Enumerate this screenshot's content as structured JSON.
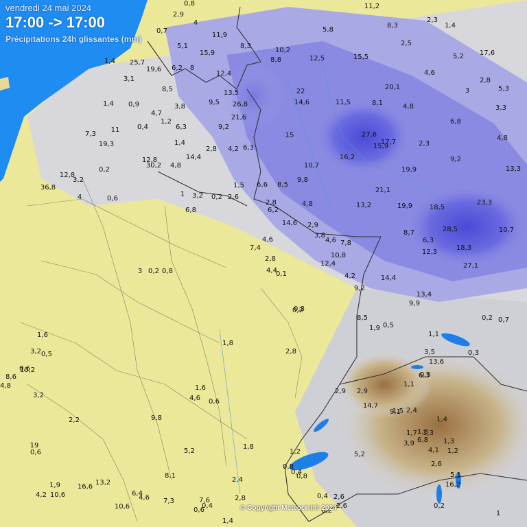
{
  "header": {
    "date": "vendredi 24 mai 2024",
    "time_range": "17:00 -> 17:00",
    "variable": "Précipitations 24h glissantes (mm)"
  },
  "copyright": "© Copyright Meteociel.fr 2024",
  "colors": {
    "sea": "#1e8cf0",
    "dry": "#f0ec9a",
    "light_gray": "#d6d6dc",
    "rain_light": "#a8a8e8",
    "rain_mid": "#8080e0",
    "rain_heavy": "#5a5ad8",
    "alps": "#b08a50"
  },
  "values": [
    {
      "t": "0,8"
    },
    {
      "t": "2,9"
    },
    {
      "t": "4"
    },
    {
      "t": "0,7"
    },
    {
      "t": "11,9"
    },
    {
      "t": "5,1"
    },
    {
      "t": "15,9"
    },
    {
      "t": "8,3"
    },
    {
      "t": "1,4"
    },
    {
      "t": "25,7"
    },
    {
      "t": "19,6"
    },
    {
      "t": "6,2"
    },
    {
      "t": "8"
    },
    {
      "t": "12,4"
    },
    {
      "t": "3,1"
    },
    {
      "t": "8,5"
    },
    {
      "t": "13,5"
    },
    {
      "t": "9,5"
    },
    {
      "t": "26,8"
    },
    {
      "t": "21,6"
    },
    {
      "t": "3,8"
    },
    {
      "t": "0,9"
    },
    {
      "t": "1,4"
    },
    {
      "t": "4,7"
    },
    {
      "t": "1,2"
    },
    {
      "t": "6,3"
    },
    {
      "t": "9,2"
    },
    {
      "t": "11"
    },
    {
      "t": "7,3"
    },
    {
      "t": "19,3"
    },
    {
      "t": "0,4"
    },
    {
      "t": "1,4"
    },
    {
      "t": "2,8"
    },
    {
      "t": "4,2"
    },
    {
      "t": "6,3"
    },
    {
      "t": "14,4"
    },
    {
      "t": "12,8"
    },
    {
      "t": "30,2"
    },
    {
      "t": "4,8"
    },
    {
      "t": "36,8"
    },
    {
      "t": "12,8"
    },
    {
      "t": "0,2"
    },
    {
      "t": "3,2"
    },
    {
      "t": "4"
    },
    {
      "t": "0,6"
    },
    {
      "t": "1"
    },
    {
      "t": "0,2"
    },
    {
      "t": "2,6"
    },
    {
      "t": "6,8"
    },
    {
      "t": "3,2"
    },
    {
      "t": "11,2"
    },
    {
      "t": "8,3"
    },
    {
      "t": "2,5"
    },
    {
      "t": "2,3"
    },
    {
      "t": "1,4"
    },
    {
      "t": "5,8"
    },
    {
      "t": "10,2"
    },
    {
      "t": "8,8"
    },
    {
      "t": "12,5"
    },
    {
      "t": "15,5"
    },
    {
      "t": "5,2"
    },
    {
      "t": "17,6"
    },
    {
      "t": "4,6"
    },
    {
      "t": "2,8"
    },
    {
      "t": "20,1"
    },
    {
      "t": "22"
    },
    {
      "t": "14,6"
    },
    {
      "t": "11,5"
    },
    {
      "t": "8,1"
    },
    {
      "t": "4,8"
    },
    {
      "t": "3"
    },
    {
      "t": "5,3"
    },
    {
      "t": "3,3"
    },
    {
      "t": "6,8"
    },
    {
      "t": "27,6"
    },
    {
      "t": "17,7"
    },
    {
      "t": "15,9"
    },
    {
      "t": "2,3"
    },
    {
      "t": "4,8"
    },
    {
      "t": "15"
    },
    {
      "t": "10,7"
    },
    {
      "t": "16,2"
    },
    {
      "t": "9,2"
    },
    {
      "t": "19,9"
    },
    {
      "t": "13,3"
    },
    {
      "t": "21,1"
    },
    {
      "t": "6,6"
    },
    {
      "t": "8,5"
    },
    {
      "t": "9,8"
    },
    {
      "t": "1,5"
    },
    {
      "t": "2,8"
    },
    {
      "t": "4,8"
    },
    {
      "t": "13,2"
    },
    {
      "t": "19,9"
    },
    {
      "t": "18,5"
    },
    {
      "t": "23,3"
    },
    {
      "t": "6,2"
    },
    {
      "t": "14,6"
    },
    {
      "t": "2,9"
    },
    {
      "t": "28,5"
    },
    {
      "t": "8,7"
    },
    {
      "t": "6,3"
    },
    {
      "t": "10,7"
    },
    {
      "t": "18,3"
    },
    {
      "t": "12,3"
    },
    {
      "t": "27,1"
    },
    {
      "t": "3,8"
    },
    {
      "t": "4,6"
    },
    {
      "t": "7,8"
    },
    {
      "t": "10,8"
    },
    {
      "t": "12,4"
    },
    {
      "t": "4,2"
    },
    {
      "t": "9,2"
    },
    {
      "t": "14,4"
    },
    {
      "t": "13,4"
    },
    {
      "t": "9,9"
    },
    {
      "t": "8,5"
    },
    {
      "t": "1,9"
    },
    {
      "t": "0,2"
    },
    {
      "t": "0,7"
    },
    {
      "t": "4,6"
    },
    {
      "t": "7,4"
    },
    {
      "t": "2,8"
    },
    {
      "t": "4,4"
    },
    {
      "t": "0,1"
    },
    {
      "t": "3"
    },
    {
      "t": "0,8"
    },
    {
      "t": "0,2"
    },
    {
      "t": "0,8"
    },
    {
      "t": "1,8"
    },
    {
      "t": "2,8"
    },
    {
      "t": "1,6"
    },
    {
      "t": "4,6"
    },
    {
      "t": "0,6"
    },
    {
      "t": "9,8"
    },
    {
      "t": "5,2"
    },
    {
      "t": "1,8"
    },
    {
      "t": "2,4"
    },
    {
      "t": "2,8"
    },
    {
      "t": "0,5"
    },
    {
      "t": "1,1"
    },
    {
      "t": "3,5"
    },
    {
      "t": "13,6"
    },
    {
      "t": "0,3"
    },
    {
      "t": "0,5"
    },
    {
      "t": "6,3"
    },
    {
      "t": "1,1"
    },
    {
      "t": "2,9"
    },
    {
      "t": "14,7"
    },
    {
      "t": "9,1"
    },
    {
      "t": "1,5"
    },
    {
      "t": "2,4"
    },
    {
      "t": "1,4"
    },
    {
      "t": "1,8"
    },
    {
      "t": "6,8"
    },
    {
      "t": "3,9"
    },
    {
      "t": "5,2"
    },
    {
      "t": "1,7"
    },
    {
      "t": "1,3"
    },
    {
      "t": "1,3"
    },
    {
      "t": "4,1"
    },
    {
      "t": "1,2"
    },
    {
      "t": "2,6"
    },
    {
      "t": "5,1"
    },
    {
      "t": "16,2"
    },
    {
      "t": "0,6"
    },
    {
      "t": "1,9"
    },
    {
      "t": "4,2"
    },
    {
      "t": "10,6"
    },
    {
      "t": "16,6"
    },
    {
      "t": "13,2"
    },
    {
      "t": "6,4"
    },
    {
      "t": "4,6"
    },
    {
      "t": "7,3"
    },
    {
      "t": "10,6"
    },
    {
      "t": "8,1"
    },
    {
      "t": "7,6"
    },
    {
      "t": "0,6"
    },
    {
      "t": "0,4"
    },
    {
      "t": "1,4"
    },
    {
      "t": "0,2"
    },
    {
      "t": "0,8"
    },
    {
      "t": "0,2"
    },
    {
      "t": "2,6"
    },
    {
      "t": "0,4"
    },
    {
      "t": "2,6"
    },
    {
      "t": "1,6"
    },
    {
      "t": "0,5"
    },
    {
      "t": "3,2"
    },
    {
      "t": "0,6"
    },
    {
      "t": "8,6"
    },
    {
      "t": "4,8"
    },
    {
      "t": "10,2"
    },
    {
      "t": "3,2"
    },
    {
      "t": "2,2"
    },
    {
      "t": "19"
    },
    {
      "t": "1,2"
    },
    {
      "t": "0,4"
    },
    {
      "t": "0,8"
    },
    {
      "t": "2,9"
    },
    {
      "t": "0,2"
    },
    {
      "t": "1"
    }
  ]
}
